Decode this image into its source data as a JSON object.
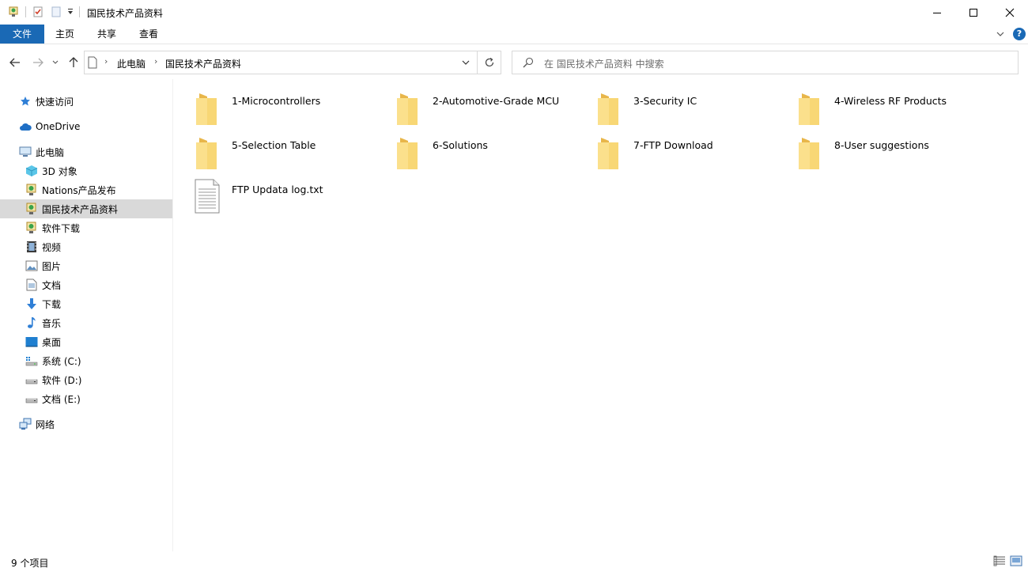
{
  "window": {
    "title": "国民技术产品资料",
    "minimize_glyph": "—",
    "maximize_glyph": "☐",
    "close_glyph": "✕"
  },
  "ribbon": {
    "tabs": [
      {
        "label": "文件"
      },
      {
        "label": "主页"
      },
      {
        "label": "共享"
      },
      {
        "label": "查看"
      }
    ],
    "help_glyph": "?"
  },
  "address": {
    "crumbs": [
      {
        "label": "此电脑"
      },
      {
        "label": "国民技术产品资料"
      }
    ],
    "search_placeholder": "在 国民技术产品资料 中搜索"
  },
  "sidebar": {
    "items": [
      {
        "label": "快速访问",
        "icon": "star-icon"
      },
      {
        "label": "OneDrive",
        "icon": "cloud-icon"
      },
      {
        "label": "此电脑",
        "icon": "computer-icon"
      },
      {
        "label": "3D 对象",
        "icon": "cube-icon"
      },
      {
        "label": "Nations产品发布",
        "icon": "network-drive-icon"
      },
      {
        "label": "国民技术产品资料",
        "icon": "network-drive-icon"
      },
      {
        "label": "软件下载",
        "icon": "network-drive-icon"
      },
      {
        "label": "视频",
        "icon": "video-icon"
      },
      {
        "label": "图片",
        "icon": "picture-icon"
      },
      {
        "label": "文档",
        "icon": "document-icon"
      },
      {
        "label": "下载",
        "icon": "download-icon"
      },
      {
        "label": "音乐",
        "icon": "music-icon"
      },
      {
        "label": "桌面",
        "icon": "desktop-icon"
      },
      {
        "label": "系统 (C:)",
        "icon": "system-drive-icon"
      },
      {
        "label": "软件 (D:)",
        "icon": "drive-icon"
      },
      {
        "label": "文档 (E:)",
        "icon": "drive-icon"
      },
      {
        "label": "网络",
        "icon": "network-icon"
      }
    ]
  },
  "files": [
    {
      "name": "1-Microcontrollers",
      "type": "folder"
    },
    {
      "name": "2-Automotive-Grade MCU",
      "type": "folder"
    },
    {
      "name": "3-Security IC",
      "type": "folder"
    },
    {
      "name": "4-Wireless RF Products",
      "type": "folder"
    },
    {
      "name": "5-Selection Table",
      "type": "folder"
    },
    {
      "name": "6-Solutions",
      "type": "folder"
    },
    {
      "name": "7-FTP Download",
      "type": "folder"
    },
    {
      "name": "8-User suggestions",
      "type": "folder"
    },
    {
      "name": "FTP Updata log.txt",
      "type": "text-file"
    }
  ],
  "status": {
    "item_count": "9 个项目"
  },
  "colors": {
    "accent": "#1a69b5",
    "folder": "#f8d775",
    "folder_dark": "#e8b64a",
    "selected_bg": "#d9d9d9"
  }
}
